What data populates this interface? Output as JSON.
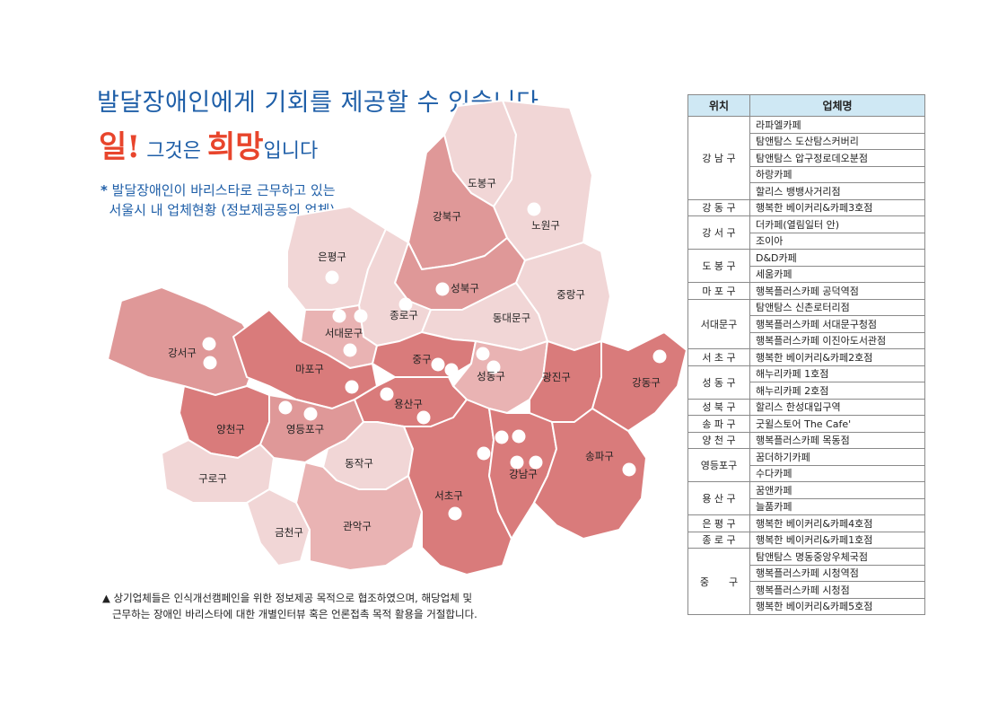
{
  "headline": {
    "line1": "발달장애인에게 기회를 제공할 수 있습니다.",
    "word_il": "일!",
    "mid": " 그것은 ",
    "word_hope": "희망",
    "end": "입니다"
  },
  "subnote": {
    "star": "*",
    "line1": "발달장애인이 바리스타로 근무하고 있는",
    "line2": "서울시 내 업체현황 (정보제공동의 업체)"
  },
  "footnote": {
    "line1": "▲ 상기업체들은 인식개선캠페인을 위한 정보제공 목적으로 협조하였으며, 해당업체 및",
    "line2": "근무하는 장애인 바리스타에 대한 개별인터뷰 혹은 언론접촉 목적 활용을 거절합니다."
  },
  "colors": {
    "title_blue": "#1f5fa8",
    "accent_red": "#e8452c",
    "table_header": "#cfe8f4",
    "marker": "#ffffff"
  },
  "map": {
    "districts": [
      {
        "name": "도봉구",
        "shade": 1
      },
      {
        "name": "노원구",
        "shade": 1
      },
      {
        "name": "강북구",
        "shade": 3
      },
      {
        "name": "은평구",
        "shade": 1
      },
      {
        "name": "성북구",
        "shade": 3
      },
      {
        "name": "중랑구",
        "shade": 1
      },
      {
        "name": "종로구",
        "shade": 1
      },
      {
        "name": "동대문구",
        "shade": 1
      },
      {
        "name": "서대문구",
        "shade": 2
      },
      {
        "name": "강서구",
        "shade": 3
      },
      {
        "name": "마포구",
        "shade": 4
      },
      {
        "name": "중구",
        "shade": 4
      },
      {
        "name": "성동구",
        "shade": 2
      },
      {
        "name": "광진구",
        "shade": 4
      },
      {
        "name": "강동구",
        "shade": 4
      },
      {
        "name": "양천구",
        "shade": 4
      },
      {
        "name": "영등포구",
        "shade": 3
      },
      {
        "name": "용산구",
        "shade": 4
      },
      {
        "name": "동작구",
        "shade": 1
      },
      {
        "name": "구로구",
        "shade": 1
      },
      {
        "name": "금천구",
        "shade": 1
      },
      {
        "name": "관악구",
        "shade": 2
      },
      {
        "name": "서초구",
        "shade": 4
      },
      {
        "name": "강남구",
        "shade": 4
      },
      {
        "name": "송파구",
        "shade": 4
      }
    ],
    "shade_colors": [
      "#ffffff",
      "#f1d6d6",
      "#e9b3b3",
      "#df9898",
      "#d97b7b"
    ]
  },
  "table": {
    "headers": [
      "위치",
      "업체명"
    ],
    "groups": [
      {
        "district": "강 남 구",
        "cafes": [
          "라파엘카페",
          "탐앤탐스 도산탐스커버리",
          "탐앤탐스 압구정로데오분점",
          "하랑카페",
          "할리스 뱅뱅사거리점"
        ]
      },
      {
        "district": "강 동 구",
        "cafes": [
          "행복한 베이커리&카페3호점"
        ]
      },
      {
        "district": "강 서 구",
        "cafes": [
          "더카페(열림일터 안)",
          "조이아"
        ]
      },
      {
        "district": "도 봉 구",
        "cafes": [
          "D&D카페",
          "세움카페"
        ]
      },
      {
        "district": "마 포 구",
        "cafes": [
          "행복플러스카페 공덕역점"
        ]
      },
      {
        "district": "서대문구",
        "cafes": [
          "탐앤탐스 신촌로터리점",
          "행복플러스카페 서대문구청점",
          "행복플러스카페 이진아도서관점"
        ]
      },
      {
        "district": "서 초 구",
        "cafes": [
          "행복한 베이커리&카페2호점"
        ]
      },
      {
        "district": "성 동 구",
        "cafes": [
          "해누리카페 1호점",
          "해누리카페 2호점"
        ]
      },
      {
        "district": "성 북 구",
        "cafes": [
          "할리스 한성대입구역"
        ]
      },
      {
        "district": "송 파 구",
        "cafes": [
          "굿윌스토어 The Cafe'"
        ]
      },
      {
        "district": "양 천 구",
        "cafes": [
          "행복플러스카페 목동점"
        ]
      },
      {
        "district": "영등포구",
        "cafes": [
          "꿈더하기카페",
          "수다카페"
        ]
      },
      {
        "district": "용 산 구",
        "cafes": [
          "꿈앤카페",
          "늘품카페"
        ]
      },
      {
        "district": "은 평 구",
        "cafes": [
          "행복한 베이커리&카페4호점"
        ]
      },
      {
        "district": "종 로 구",
        "cafes": [
          "행복한 베이커리&카페1호점"
        ]
      },
      {
        "district": "중　　구",
        "cafes": [
          "탐앤탐스 명동중앙우체국점",
          "행복플러스카페 시청역점",
          "행복플러스카페 시청점",
          "행복한 베이커리&카페5호점"
        ]
      }
    ]
  }
}
